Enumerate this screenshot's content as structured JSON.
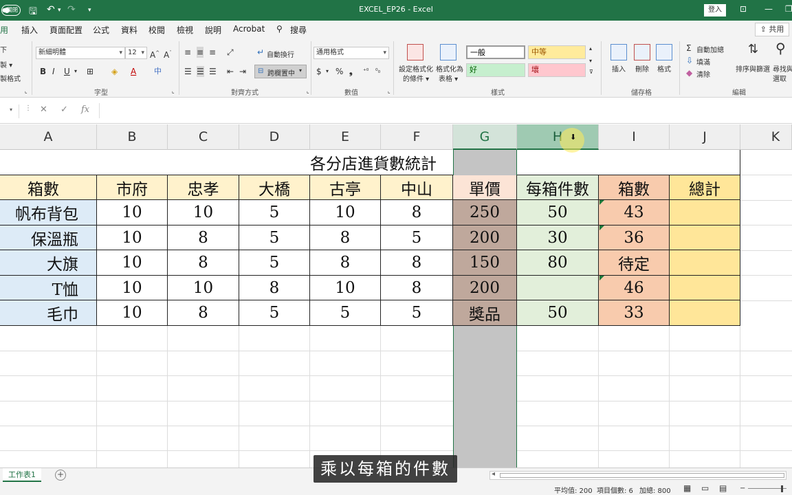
{
  "titlebar": {
    "autosave_label": "●關閉",
    "doc_title": "EXCEL_EP26 - Excel",
    "signin_label": "登入"
  },
  "ribbon_tabs": [
    "用",
    "插入",
    "頁面配置",
    "公式",
    "資料",
    "校閱",
    "檢視",
    "說明",
    "Acrobat",
    "搜尋"
  ],
  "share_label": "共用",
  "clipboard": {
    "cut": "下",
    "copy": "製 ▾",
    "format_painter": "製格式"
  },
  "font": {
    "name": "新細明體",
    "size": "12",
    "group_label": "字型"
  },
  "alignment": {
    "wrap_text": "自動換行",
    "merge_center": "跨欄置中",
    "group_label": "對齊方式"
  },
  "number": {
    "format": "通用格式",
    "group_label": "數值"
  },
  "styles": {
    "conditional": [
      "設定格式化",
      "的條件 ▾"
    ],
    "as_table": [
      "格式化為",
      "表格 ▾"
    ],
    "normal": "一般",
    "neutral": "中等",
    "good": "好",
    "bad": "壞",
    "group_label": "樣式"
  },
  "cells_group": {
    "insert": "插入",
    "delete": "刪除",
    "format": "格式",
    "group_label": "儲存格"
  },
  "editing": {
    "autosum": "自動加總",
    "fill": "填滿",
    "clear": "清除",
    "sort_filter": "排序與篩選",
    "find_select": [
      "尋找與",
      "選取"
    ],
    "group_label": "編輯"
  },
  "formula_bar": {
    "fx": "fx"
  },
  "columns": [
    "A",
    "B",
    "C",
    "D",
    "E",
    "F",
    "G",
    "H",
    "I",
    "J",
    "K"
  ],
  "sheet": {
    "title": "各分店進貨數統計",
    "headers": [
      "箱數",
      "市府",
      "忠孝",
      "大橋",
      "古亭",
      "中山",
      "單價",
      "每箱件數",
      "箱數",
      "總計"
    ],
    "rows": [
      [
        "帆布背包",
        "10",
        "10",
        "5",
        "10",
        "8",
        "250",
        "50",
        "43",
        ""
      ],
      [
        "保溫瓶",
        "10",
        "8",
        "5",
        "8",
        "5",
        "200",
        "30",
        "36",
        ""
      ],
      [
        "大旗",
        "10",
        "8",
        "5",
        "8",
        "8",
        "150",
        "80",
        "待定",
        ""
      ],
      [
        "T恤",
        "10",
        "10",
        "8",
        "10",
        "8",
        "200",
        "",
        "46",
        ""
      ],
      [
        "毛巾",
        "10",
        "8",
        "5",
        "5",
        "5",
        "獎品",
        "50",
        "33",
        ""
      ]
    ]
  },
  "colors": {
    "excel_green": "#217346",
    "header_yellow": "#fff2cc",
    "names_blue": "#ddebf7",
    "price_fill": "#bfa89c",
    "per_box_fill": "#e2efda",
    "boxes_fill": "#f8cbad",
    "total_fill": "#ffe699",
    "selection_gray": "#c4c4c4"
  },
  "sheet_tab": "工作表1",
  "subtitle": "乘以每箱的件數",
  "status": {
    "average": "平均值: 200",
    "count": "項目個數: 6",
    "sum": "加總: 800"
  }
}
